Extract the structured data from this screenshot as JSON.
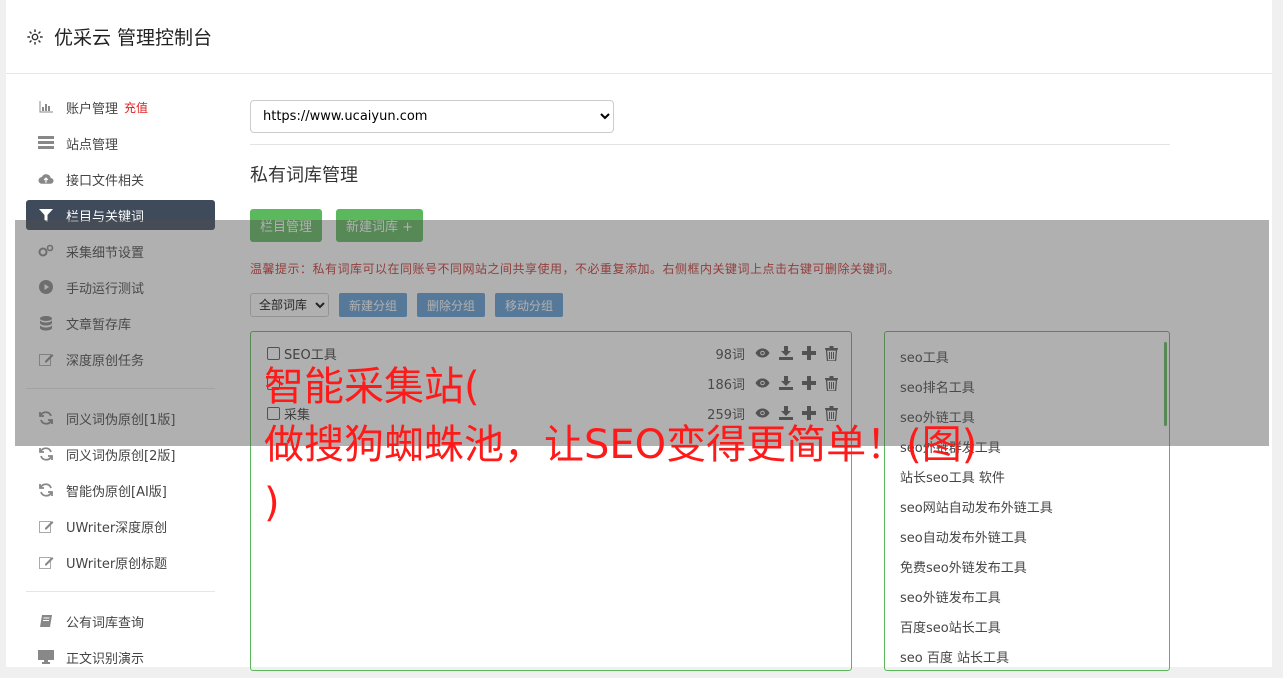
{
  "header": {
    "title": "优采云 管理控制台"
  },
  "sidebar": {
    "items": [
      {
        "label": "账户管理",
        "badge": "充值",
        "icon": "bar-chart-icon"
      },
      {
        "label": "站点管理",
        "icon": "server-icon"
      },
      {
        "label": "接口文件相关",
        "icon": "cloud-upload-icon"
      },
      {
        "label": "栏目与关键词",
        "icon": "filter-icon",
        "active": true
      },
      {
        "label": "采集细节设置",
        "icon": "gears-icon"
      },
      {
        "label": "手动运行测试",
        "icon": "play-icon"
      },
      {
        "label": "文章暂存库",
        "icon": "database-icon"
      },
      {
        "label": "深度原创任务",
        "icon": "edit-icon"
      }
    ],
    "items2": [
      {
        "label": "同义词伪原创[1版]",
        "icon": "refresh-icon"
      },
      {
        "label": "同义词伪原创[2版]",
        "icon": "refresh-icon"
      },
      {
        "label": "智能伪原创[AI版]",
        "icon": "refresh-icon"
      },
      {
        "label": "UWriter深度原创",
        "icon": "edit-icon"
      },
      {
        "label": "UWriter原创标题",
        "icon": "edit-icon"
      }
    ],
    "items3": [
      {
        "label": "公有词库查询",
        "icon": "book-icon"
      },
      {
        "label": "正文识别演示",
        "icon": "monitor-icon"
      }
    ]
  },
  "main": {
    "url_select": "https://www.ucaiyun.com",
    "section_title": "私有词库管理",
    "btn_column": "栏目管理",
    "btn_new_lib": "新建词库 +",
    "tip": "温馨提示：私有词库可以在同账号不同网站之间共享使用，不必重复添加。右侧框内关键词上点击右键可删除关键词。",
    "group_select": "全部词库",
    "btn_new_group": "新建分组",
    "btn_del_group": "删除分组",
    "btn_move_group": "移动分组",
    "libraries": [
      {
        "name": "SEO工具",
        "count": "98词"
      },
      {
        "name": "",
        "count": "186词"
      },
      {
        "name": "采集",
        "count": "259词"
      }
    ],
    "keywords": [
      "seo工具",
      "seo排名工具",
      "seo外链工具",
      "seo外链群发工具",
      "站长seo工具 软件",
      "seo网站自动发布外链工具",
      "seo自动发布外链工具",
      "免费seo外链发布工具",
      "seo外链发布工具",
      "百度seo站长工具",
      "seo 百度 站长工具"
    ]
  },
  "overlay_text": "智能采集站(\n做搜狗蜘蛛池，让SEO变得更简单！(图)\n)",
  "colors": {
    "green": "#5cb85c",
    "blue": "#5b9bd5",
    "red": "#ff1a1a",
    "sidebar_active": "#3f4a5a"
  }
}
